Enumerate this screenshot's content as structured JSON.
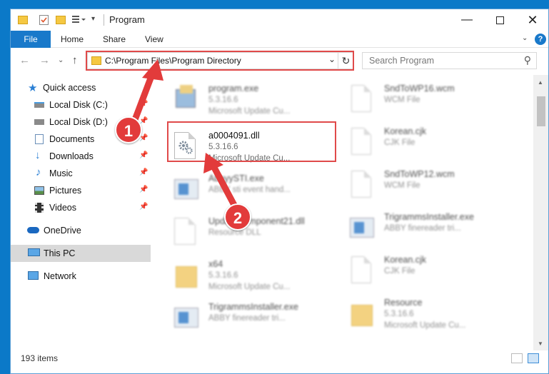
{
  "window": {
    "title": "Program"
  },
  "ribbon": {
    "tabs": [
      "File",
      "Home",
      "Share",
      "View"
    ],
    "help": "?"
  },
  "address": {
    "path": "C:\\Program Files\\Program Directory"
  },
  "search": {
    "placeholder": "Search Program"
  },
  "sidebar": {
    "items": [
      {
        "label": "Quick access",
        "icon": "star-icon"
      },
      {
        "label": "Local Disk (C:)",
        "icon": "drive-icon"
      },
      {
        "label": "Local Disk (D:)",
        "icon": "drive-icon"
      },
      {
        "label": "Documents",
        "icon": "documents-icon"
      },
      {
        "label": "Downloads",
        "icon": "download-icon"
      },
      {
        "label": "Music",
        "icon": "music-icon"
      },
      {
        "label": "Pictures",
        "icon": "pictures-icon"
      },
      {
        "label": "Videos",
        "icon": "videos-icon"
      },
      {
        "label": "OneDrive",
        "icon": "cloud-icon"
      },
      {
        "label": "This PC",
        "icon": "computer-icon"
      },
      {
        "label": "Network",
        "icon": "network-icon"
      }
    ]
  },
  "files": {
    "left": [
      {
        "name": "program.exe",
        "line1": "5.3.16.6",
        "line2": "Microsoft Update Cu..."
      },
      {
        "name": "a0004091.dll",
        "line1": "5.3.16.6",
        "line2": "Microsoft Update Cu..."
      },
      {
        "name": "AbbyySTI.exe",
        "line1": "ABBY sti event hand...",
        "line2": ""
      },
      {
        "name": "UpdateComponent21.dll",
        "line1": "Resource DLL",
        "line2": ""
      },
      {
        "name": "x64",
        "line1": "5.3.16.6",
        "line2": "Microsoft Update Cu..."
      },
      {
        "name": "TrigrammsInstaller.exe",
        "line1": "ABBY finereader tri...",
        "line2": ""
      }
    ],
    "right": [
      {
        "name": "SndToWP16.wcm",
        "line1": "WCM File",
        "line2": ""
      },
      {
        "name": "Korean.cjk",
        "line1": "CJK File",
        "line2": ""
      },
      {
        "name": "SndToWP12.wcm",
        "line1": "WCM File",
        "line2": ""
      },
      {
        "name": "TrigrammsInstaller.exe",
        "line1": "ABBY finereader tri...",
        "line2": ""
      },
      {
        "name": "Korean.cjk",
        "line1": "CJK File",
        "line2": ""
      },
      {
        "name": "Resource",
        "line1": "5.3.16.6",
        "line2": "Microsoft Update Cu..."
      }
    ]
  },
  "status": {
    "count": "193 items"
  },
  "annotations": {
    "step1": "1",
    "step2": "2"
  },
  "colors": {
    "accent": "#1979ca",
    "highlight": "#e04a4a"
  }
}
